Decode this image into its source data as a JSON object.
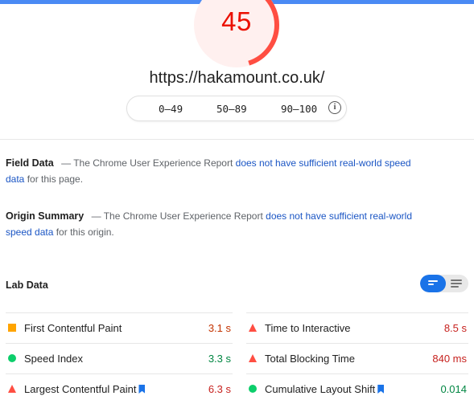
{
  "colors": {
    "fail": "#ff4e42",
    "average": "#ffa400",
    "pass": "#0cce6b",
    "accent": "#1a73e8",
    "link": "#1a55c4"
  },
  "score": {
    "value": "45",
    "fraction": 0.45
  },
  "url": "https://hakamount.co.uk/",
  "legend": [
    {
      "label": "0–49",
      "color": "#ff4e42"
    },
    {
      "label": "50–89",
      "color": "#ffa400"
    },
    {
      "label": "90–100",
      "color": "#0cce6b"
    }
  ],
  "info_icon": "info-icon",
  "field_data": {
    "title": "Field Data",
    "prefix": "— The Chrome User Experience Report ",
    "link": "does not have sufficient real-world speed data",
    "suffix": " for this page."
  },
  "origin_summary": {
    "title": "Origin Summary",
    "prefix": "— The Chrome User Experience Report ",
    "link": "does not have sufficient real-world speed data",
    "suffix": " for this origin."
  },
  "lab_data": {
    "title": "Lab Data",
    "metrics": [
      {
        "label": "First Contentful Paint",
        "value": "3.1 s",
        "rating": "average",
        "bookmark": false
      },
      {
        "label": "Time to Interactive",
        "value": "8.5 s",
        "rating": "fail",
        "bookmark": false
      },
      {
        "label": "Speed Index",
        "value": "3.3 s",
        "rating": "pass",
        "bookmark": false
      },
      {
        "label": "Total Blocking Time",
        "value": "840 ms",
        "rating": "fail",
        "bookmark": false
      },
      {
        "label": "Largest Contentful Paint",
        "value": "6.3 s",
        "rating": "fail",
        "bookmark": true
      },
      {
        "label": "Cumulative Layout Shift",
        "value": "0.014",
        "rating": "pass",
        "bookmark": true
      }
    ]
  }
}
